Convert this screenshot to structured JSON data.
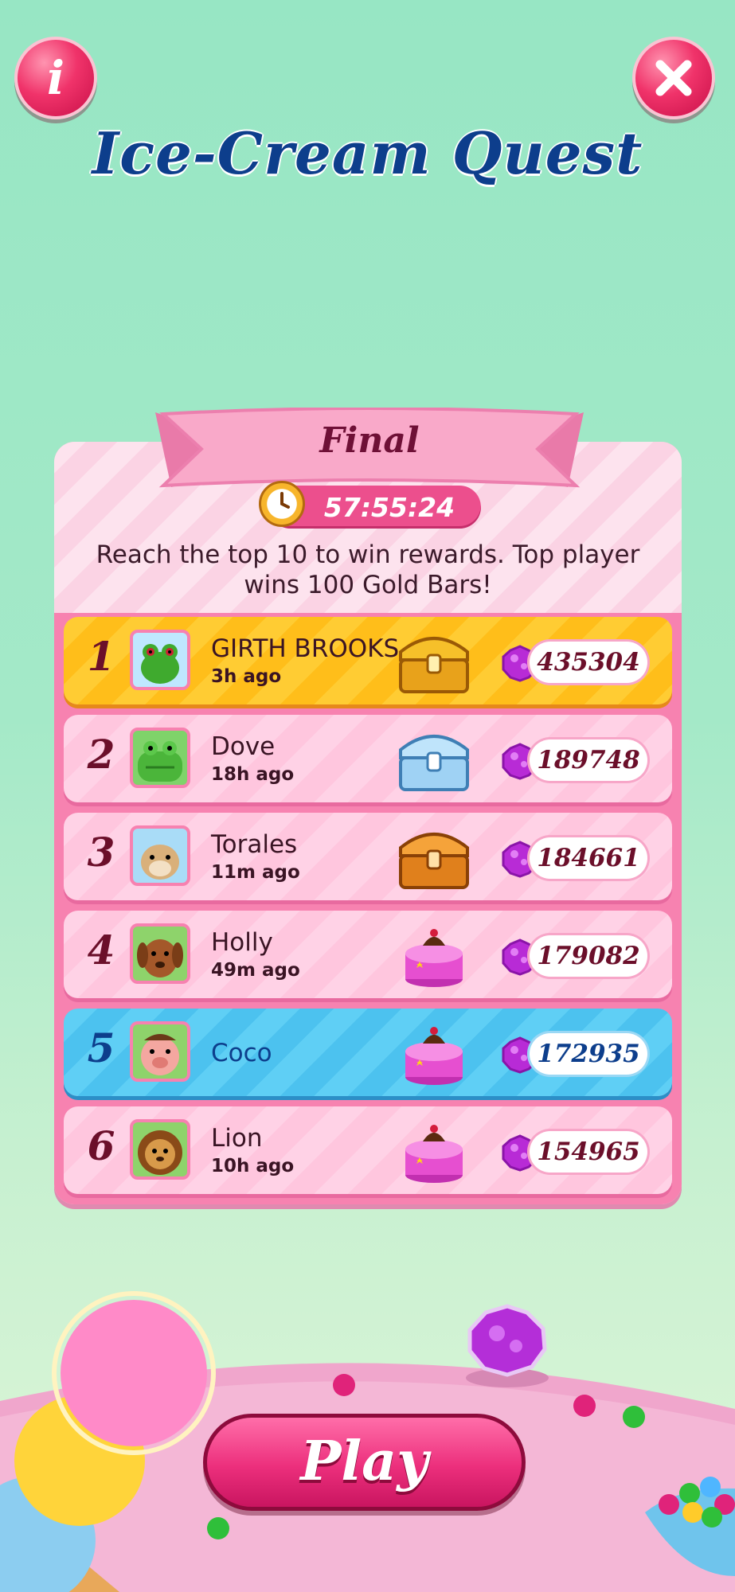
{
  "header": {
    "info_label": "i",
    "title": "Ice-Cream Quest"
  },
  "event": {
    "stage": "Final",
    "timer": "57:55:24",
    "description": "Reach the top 10 to win rewards. Top player wins 100 Gold Bars!"
  },
  "leaderboard": [
    {
      "rank": "1",
      "name": "GIRTH BROOKS",
      "time": "3h ago",
      "score": "435304",
      "reward": "gold-chest-icon",
      "style": "gold"
    },
    {
      "rank": "2",
      "name": "Dove",
      "time": "18h ago",
      "score": "189748",
      "reward": "blue-chest-icon",
      "style": "pink"
    },
    {
      "rank": "3",
      "name": "Torales",
      "time": "11m ago",
      "score": "184661",
      "reward": "bronze-chest-icon",
      "style": "pink"
    },
    {
      "rank": "4",
      "name": "Holly",
      "time": "49m ago",
      "score": "179082",
      "reward": "cake-icon",
      "style": "pink"
    },
    {
      "rank": "5",
      "name": "Coco",
      "time": "",
      "score": "172935",
      "reward": "cake-icon",
      "style": "blue"
    },
    {
      "rank": "6",
      "name": "Lion",
      "time": "10h ago",
      "score": "154965",
      "reward": "cake-icon",
      "style": "pink"
    }
  ],
  "footer": {
    "play_label": "Play"
  },
  "colors": {
    "title": "#0d3e8c",
    "accent_pink": "#ec2f7c",
    "gold_row": "#ffcc33",
    "self_row": "#5fcff5"
  }
}
